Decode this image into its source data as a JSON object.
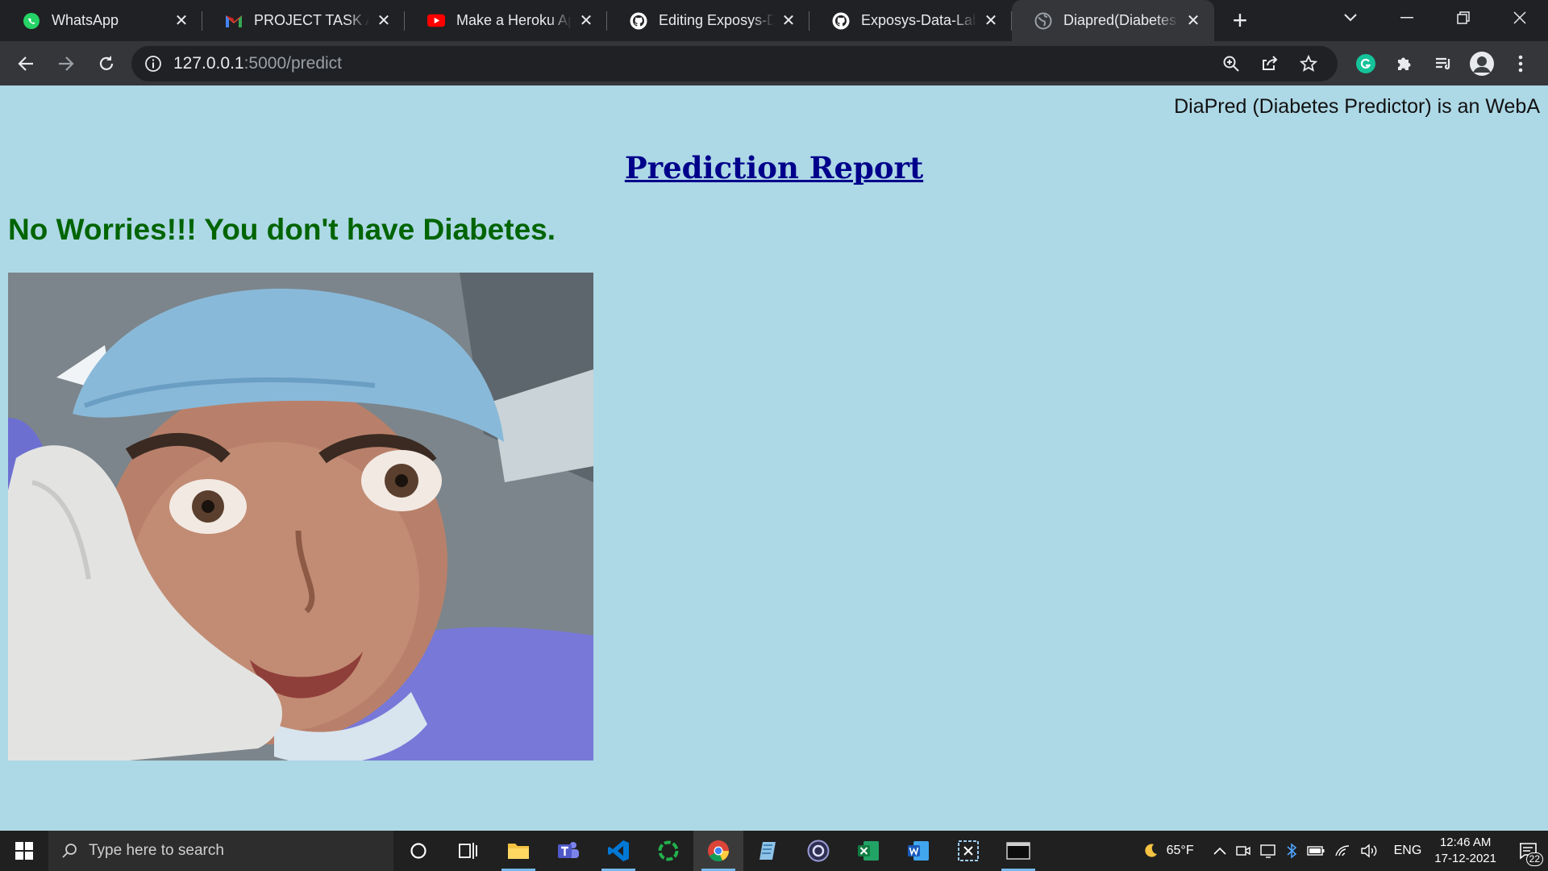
{
  "browser": {
    "tabs": [
      {
        "title": "WhatsApp",
        "icon": "whatsapp-icon",
        "active": false
      },
      {
        "title": "PROJECT TASK ALLOCATION",
        "icon": "gmail-icon",
        "active": false
      },
      {
        "title": "Make a Heroku App",
        "icon": "youtube-icon",
        "active": false
      },
      {
        "title": "Editing Exposys-Data",
        "icon": "github-icon",
        "active": false
      },
      {
        "title": "Exposys-Data-Labs-I",
        "icon": "github-icon",
        "active": false
      },
      {
        "title": "Diapred(Diabetes Pre",
        "icon": "globe-icon",
        "active": true
      }
    ],
    "new_tab_label": "+",
    "address": {
      "host": "127.0.0.1",
      "path": ":5000/predict"
    }
  },
  "page": {
    "marquee_text": "DiaPred (Diabetes Predictor) is an WebA",
    "heading": "Prediction Report",
    "result_text": "No Worries!!! You don't have Diabetes."
  },
  "taskbar": {
    "search_placeholder": "Type here to search",
    "weather": "65°F",
    "language": "ENG",
    "time": "12:46 AM",
    "date": "17-12-2021",
    "notification_count": "22"
  },
  "colors": {
    "page_bg": "#add8e6",
    "heading": "#00008b",
    "result": "#006400"
  }
}
